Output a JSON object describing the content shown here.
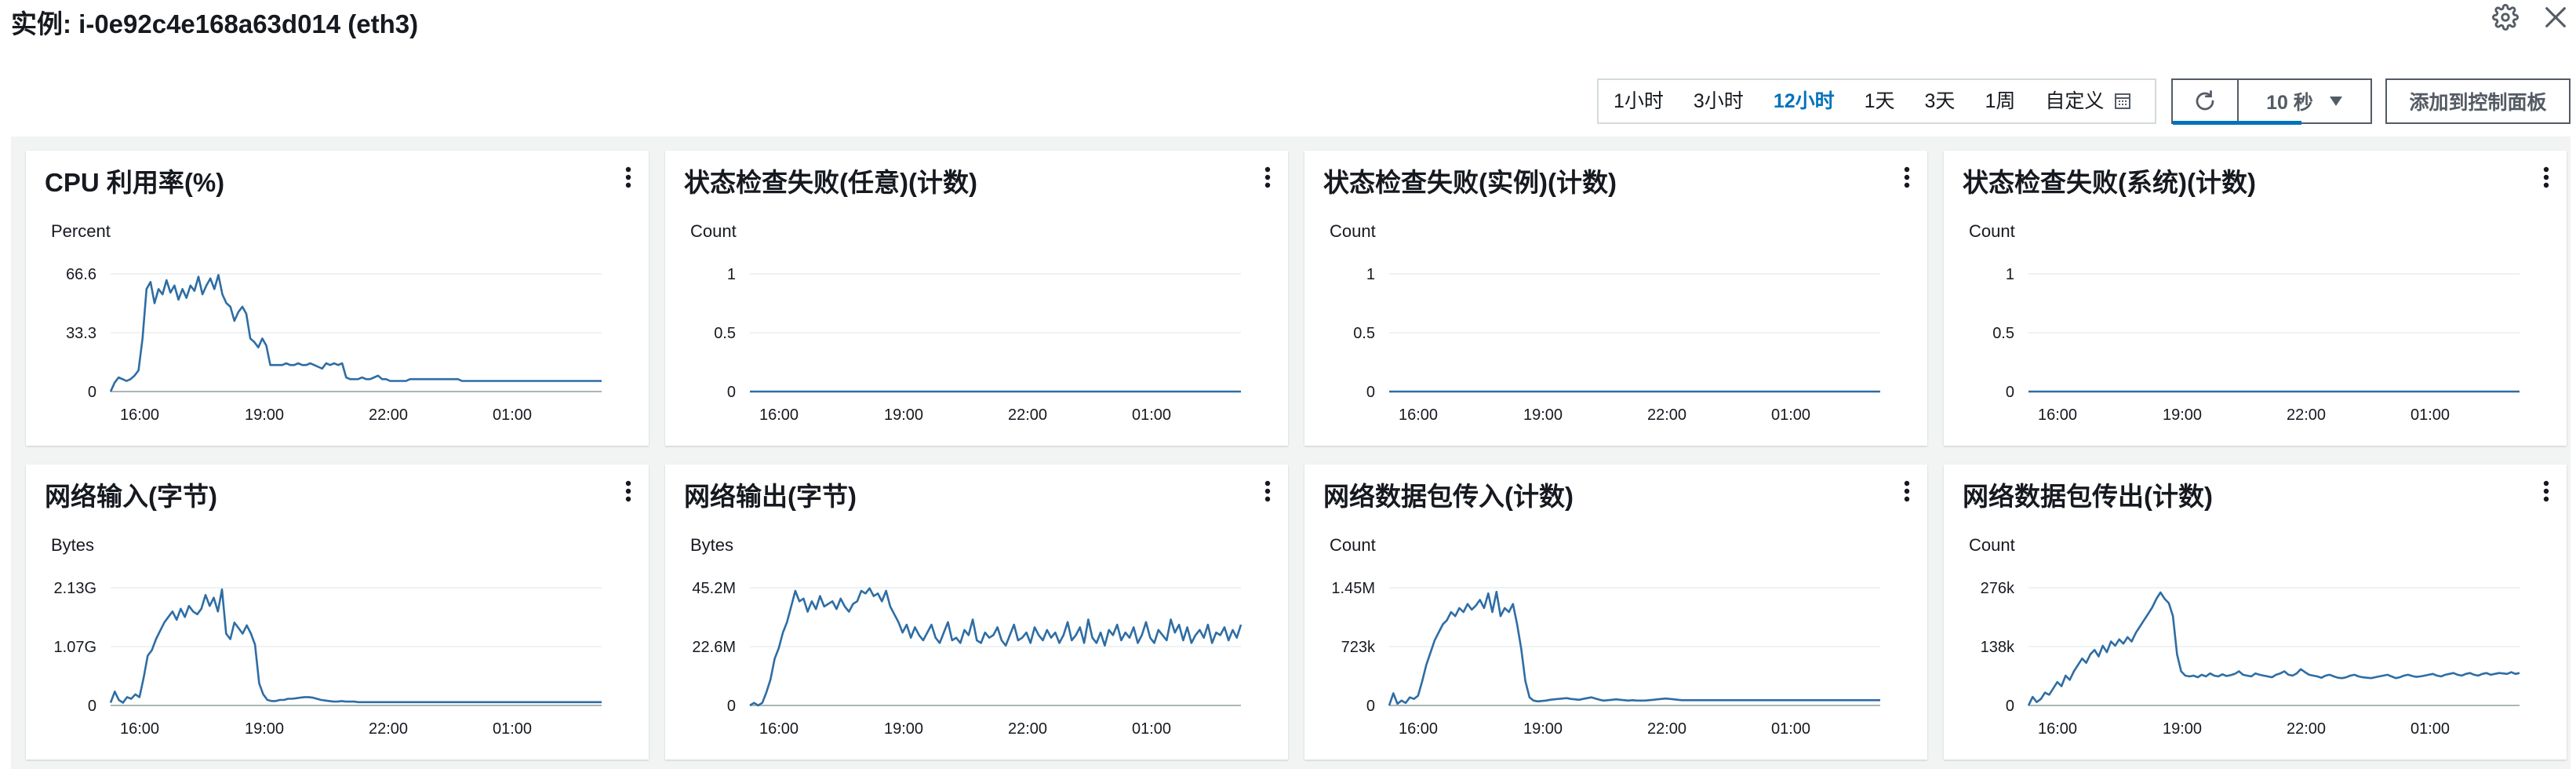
{
  "header": {
    "title": "实例: i-0e92c4e168a63d014 (eth3)"
  },
  "toolbar": {
    "ranges": [
      "1小时",
      "3小时",
      "12小时",
      "1天",
      "3天",
      "1周"
    ],
    "active_range": "12小时",
    "custom_label": "自定义",
    "interval_label": "10 秒",
    "add_label": "添加到控制面板"
  },
  "colors": {
    "line": "#2e6da4",
    "accent": "#0073bb",
    "grid": "#eaeded"
  },
  "widgets": [
    {
      "title": "CPU 利用率(%)",
      "unit": "Percent",
      "chart_data": {
        "type": "line",
        "x_ticks": [
          "16:00",
          "19:00",
          "22:00",
          "01:00"
        ],
        "y_ticks": [
          "0",
          "33.3",
          "66.6"
        ],
        "ylim": [
          0,
          66.6
        ],
        "values": [
          0,
          5,
          8,
          7,
          6,
          7,
          9,
          12,
          30,
          58,
          62,
          50,
          58,
          55,
          63,
          56,
          60,
          52,
          58,
          53,
          60,
          57,
          65,
          55,
          60,
          64,
          58,
          66,
          55,
          50,
          48,
          40,
          45,
          48,
          44,
          30,
          28,
          25,
          30,
          26,
          15,
          15,
          15,
          15,
          16,
          15,
          15,
          16,
          15,
          15,
          16,
          15,
          14,
          13,
          16,
          15,
          16,
          15,
          16,
          8,
          7,
          7,
          7,
          8,
          7,
          7,
          8,
          9,
          7,
          7,
          6,
          6,
          6,
          6,
          6,
          7,
          7,
          7,
          7,
          7,
          7,
          7,
          7,
          7,
          7,
          7,
          7,
          7,
          6,
          6,
          6,
          6,
          6,
          6,
          6,
          6,
          6,
          6,
          6,
          6,
          6,
          6,
          6,
          6,
          6,
          6,
          6,
          6,
          6,
          6,
          6,
          6,
          6,
          6,
          6,
          6,
          6,
          6,
          6,
          6,
          6,
          6,
          6,
          6
        ]
      }
    },
    {
      "title": "状态检查失败(任意)(计数)",
      "unit": "Count",
      "chart_data": {
        "type": "line",
        "x_ticks": [
          "16:00",
          "19:00",
          "22:00",
          "01:00"
        ],
        "y_ticks": [
          "0",
          "0.5",
          "1"
        ],
        "ylim": [
          0,
          1
        ],
        "values": [
          0,
          0
        ]
      }
    },
    {
      "title": "状态检查失败(实例)(计数)",
      "unit": "Count",
      "chart_data": {
        "type": "line",
        "x_ticks": [
          "16:00",
          "19:00",
          "22:00",
          "01:00"
        ],
        "y_ticks": [
          "0",
          "0.5",
          "1"
        ],
        "ylim": [
          0,
          1
        ],
        "values": [
          0,
          0
        ]
      }
    },
    {
      "title": "状态检查失败(系统)(计数)",
      "unit": "Count",
      "chart_data": {
        "type": "line",
        "x_ticks": [
          "16:00",
          "19:00",
          "22:00",
          "01:00"
        ],
        "y_ticks": [
          "0",
          "0.5",
          "1"
        ],
        "ylim": [
          0,
          1
        ],
        "values": [
          0,
          0
        ]
      }
    },
    {
      "title": "网络输入(字节)",
      "unit": "Bytes",
      "chart_data": {
        "type": "line",
        "x_ticks": [
          "16:00",
          "19:00",
          "22:00",
          "01:00"
        ],
        "y_ticks": [
          "0",
          "1.07G",
          "2.13G"
        ],
        "ylim": [
          0,
          2.13
        ],
        "values": [
          0.05,
          0.25,
          0.1,
          0.05,
          0.15,
          0.12,
          0.2,
          0.15,
          0.5,
          0.9,
          1.0,
          1.2,
          1.35,
          1.5,
          1.6,
          1.7,
          1.55,
          1.75,
          1.6,
          1.8,
          1.7,
          1.65,
          1.75,
          2.0,
          1.8,
          1.95,
          1.7,
          2.1,
          1.3,
          1.2,
          1.5,
          1.4,
          1.3,
          1.45,
          1.3,
          1.1,
          0.4,
          0.2,
          0.1,
          0.08,
          0.08,
          0.1,
          0.1,
          0.12,
          0.12,
          0.13,
          0.14,
          0.15,
          0.15,
          0.14,
          0.12,
          0.1,
          0.09,
          0.08,
          0.07,
          0.07,
          0.08,
          0.07,
          0.07,
          0.07,
          0.06,
          0.06,
          0.06,
          0.06,
          0.06,
          0.06,
          0.06,
          0.06,
          0.06,
          0.06,
          0.06,
          0.06,
          0.06,
          0.06,
          0.06,
          0.06,
          0.06,
          0.06,
          0.06,
          0.06,
          0.06,
          0.06,
          0.06,
          0.06,
          0.06,
          0.06,
          0.06,
          0.06,
          0.06,
          0.06,
          0.06,
          0.06,
          0.06,
          0.06,
          0.06,
          0.06,
          0.06,
          0.06,
          0.06,
          0.06,
          0.06,
          0.06,
          0.06,
          0.06,
          0.06,
          0.06,
          0.06,
          0.06,
          0.06,
          0.06,
          0.06,
          0.06,
          0.06,
          0.06,
          0.06,
          0.06,
          0.06,
          0.06,
          0.06,
          0.06
        ]
      }
    },
    {
      "title": "网络输出(字节)",
      "unit": "Bytes",
      "chart_data": {
        "type": "line",
        "x_ticks": [
          "16:00",
          "19:00",
          "22:00",
          "01:00"
        ],
        "y_ticks": [
          "0",
          "22.6M",
          "45.2M"
        ],
        "ylim": [
          0,
          45.2
        ],
        "values": [
          0,
          1,
          0,
          1,
          5,
          10,
          18,
          22,
          28,
          32,
          38,
          44,
          40,
          41,
          36,
          40,
          37,
          42,
          38,
          39,
          40,
          37,
          41,
          38,
          36,
          39,
          40,
          44,
          43,
          45,
          42,
          43,
          40,
          44,
          38,
          35,
          32,
          28,
          31,
          26,
          30,
          27,
          25,
          28,
          31,
          26,
          24,
          28,
          32,
          25,
          26,
          24,
          29,
          27,
          33,
          25,
          24,
          28,
          26,
          27,
          30,
          25,
          23,
          27,
          31,
          25,
          26,
          28,
          24,
          30,
          27,
          25,
          29,
          26,
          28,
          24,
          27,
          32,
          25,
          27,
          30,
          24,
          33,
          26,
          24,
          28,
          23,
          29,
          27,
          31,
          25,
          28,
          26,
          30,
          24,
          27,
          32,
          26,
          24,
          29,
          27,
          25,
          33,
          28,
          31,
          25,
          30,
          24,
          27,
          29,
          26,
          31,
          24,
          28,
          27,
          30,
          25,
          29,
          26,
          31
        ]
      }
    },
    {
      "title": "网络数据包传入(计数)",
      "unit": "Count",
      "chart_data": {
        "type": "line",
        "x_ticks": [
          "16:00",
          "19:00",
          "22:00",
          "01:00"
        ],
        "y_ticks": [
          "0",
          "723k",
          "1.45M"
        ],
        "ylim": [
          0,
          1450
        ],
        "values": [
          0,
          150,
          20,
          60,
          30,
          100,
          80,
          120,
          300,
          500,
          650,
          800,
          900,
          1000,
          1050,
          1150,
          1100,
          1200,
          1150,
          1250,
          1180,
          1230,
          1300,
          1200,
          1380,
          1150,
          1400,
          1100,
          1200,
          1150,
          1250,
          1000,
          700,
          300,
          100,
          60,
          50,
          55,
          60,
          70,
          75,
          80,
          85,
          90,
          80,
          75,
          70,
          80,
          90,
          100,
          85,
          70,
          60,
          65,
          70,
          75,
          70,
          65,
          60,
          65,
          60,
          60,
          60,
          65,
          70,
          75,
          80,
          85,
          80,
          75,
          70,
          65,
          65,
          65,
          65,
          65,
          65,
          65,
          65,
          65,
          65,
          65,
          65,
          65,
          65,
          65,
          65,
          65,
          65,
          65,
          65,
          65,
          65,
          65,
          65,
          65,
          65,
          65,
          65,
          65,
          65,
          65,
          65,
          65,
          65,
          65,
          65,
          65,
          65,
          65,
          65,
          65,
          65,
          65,
          65,
          65,
          65,
          65,
          65,
          65
        ]
      }
    },
    {
      "title": "网络数据包传出(计数)",
      "unit": "Count",
      "chart_data": {
        "type": "line",
        "x_ticks": [
          "16:00",
          "19:00",
          "22:00",
          "01:00"
        ],
        "y_ticks": [
          "0",
          "138k",
          "276k"
        ],
        "ylim": [
          0,
          276
        ],
        "values": [
          0,
          20,
          8,
          15,
          30,
          25,
          40,
          55,
          45,
          70,
          60,
          80,
          95,
          110,
          100,
          120,
          130,
          115,
          140,
          125,
          150,
          140,
          155,
          145,
          160,
          150,
          170,
          185,
          200,
          215,
          230,
          250,
          265,
          250,
          240,
          210,
          120,
          80,
          70,
          68,
          70,
          66,
          72,
          68,
          75,
          70,
          68,
          73,
          69,
          71,
          74,
          80,
          72,
          70,
          68,
          75,
          72,
          70,
          68,
          66,
          72,
          75,
          80,
          72,
          70,
          75,
          85,
          78,
          72,
          70,
          68,
          65,
          70,
          72,
          68,
          65,
          64,
          66,
          70,
          72,
          68,
          66,
          65,
          64,
          66,
          68,
          70,
          72,
          68,
          64,
          66,
          70,
          72,
          69,
          67,
          68,
          70,
          72,
          74,
          70,
          68,
          72,
          74,
          76,
          72,
          70,
          74,
          76,
          72,
          70,
          74,
          76,
          72,
          74,
          76,
          75,
          74,
          78,
          74,
          76
        ]
      }
    }
  ]
}
